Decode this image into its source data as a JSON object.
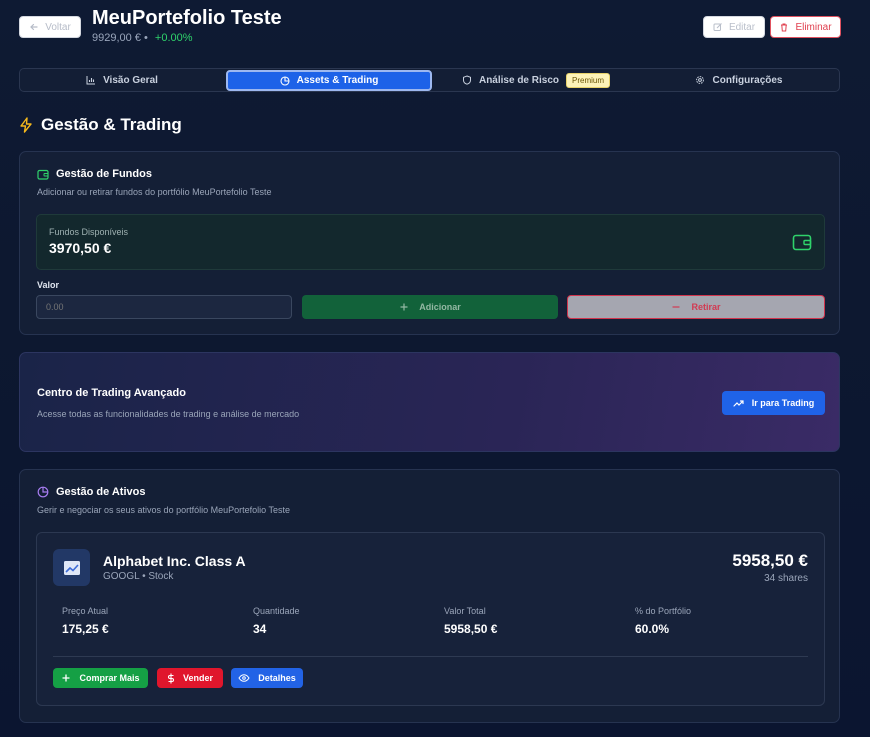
{
  "header": {
    "back_label": "Voltar",
    "title": "MeuPortefolio Teste",
    "value": "9929,00 €",
    "separator": "•",
    "change": "+0.00%",
    "edit_label": "Editar",
    "delete_label": "Eliminar"
  },
  "tabs": [
    {
      "label": "Visão Geral",
      "icon": "bar-chart-icon"
    },
    {
      "label": "Assets & Trading",
      "icon": "pie-chart-icon",
      "active": true
    },
    {
      "label": "Análise de Risco",
      "icon": "shield-icon",
      "badge": "Premium"
    },
    {
      "label": "Configurações",
      "icon": "gear-icon"
    }
  ],
  "section": {
    "title": "Gestão & Trading",
    "icon": "lightning-icon",
    "icon_color": "#f5b81c"
  },
  "funds": {
    "title": "Gestão de Fundos",
    "description": "Adicionar ou retirar fundos do portfólio MeuPortefolio Teste",
    "available_label": "Fundos Disponíveis",
    "available_value": "3970,50 €",
    "value_label": "Valor",
    "input_placeholder": "0.00",
    "add_label": "Adicionar",
    "withdraw_label": "Retirar"
  },
  "trading": {
    "title": "Centro de Trading Avançado",
    "description": "Acesse todas as funcionalidades de trading e análise de mercado",
    "button_label": "Ir para Trading"
  },
  "assets": {
    "title": "Gestão de Ativos",
    "description": "Gerir e negociar os seus ativos do portfólio MeuPortefolio Teste",
    "items": [
      {
        "name": "Alphabet Inc. Class A",
        "subtitle": "GOOGL • Stock",
        "total": "5958,50 €",
        "shares": "34 shares",
        "stats": [
          {
            "label": "Preço Atual",
            "value": "175,25 €"
          },
          {
            "label": "Quantidade",
            "value": "34"
          },
          {
            "label": "Valor Total",
            "value": "5958,50 €"
          },
          {
            "label": "% do Portfólio",
            "value": "60.0%"
          }
        ],
        "buy_label": "Comprar Mais",
        "sell_label": "Vender",
        "details_label": "Detalhes"
      }
    ]
  },
  "colors": {
    "accent_blue": "#1f63e8",
    "positive_green": "#2fd36b",
    "danger_red": "#e0162c"
  }
}
